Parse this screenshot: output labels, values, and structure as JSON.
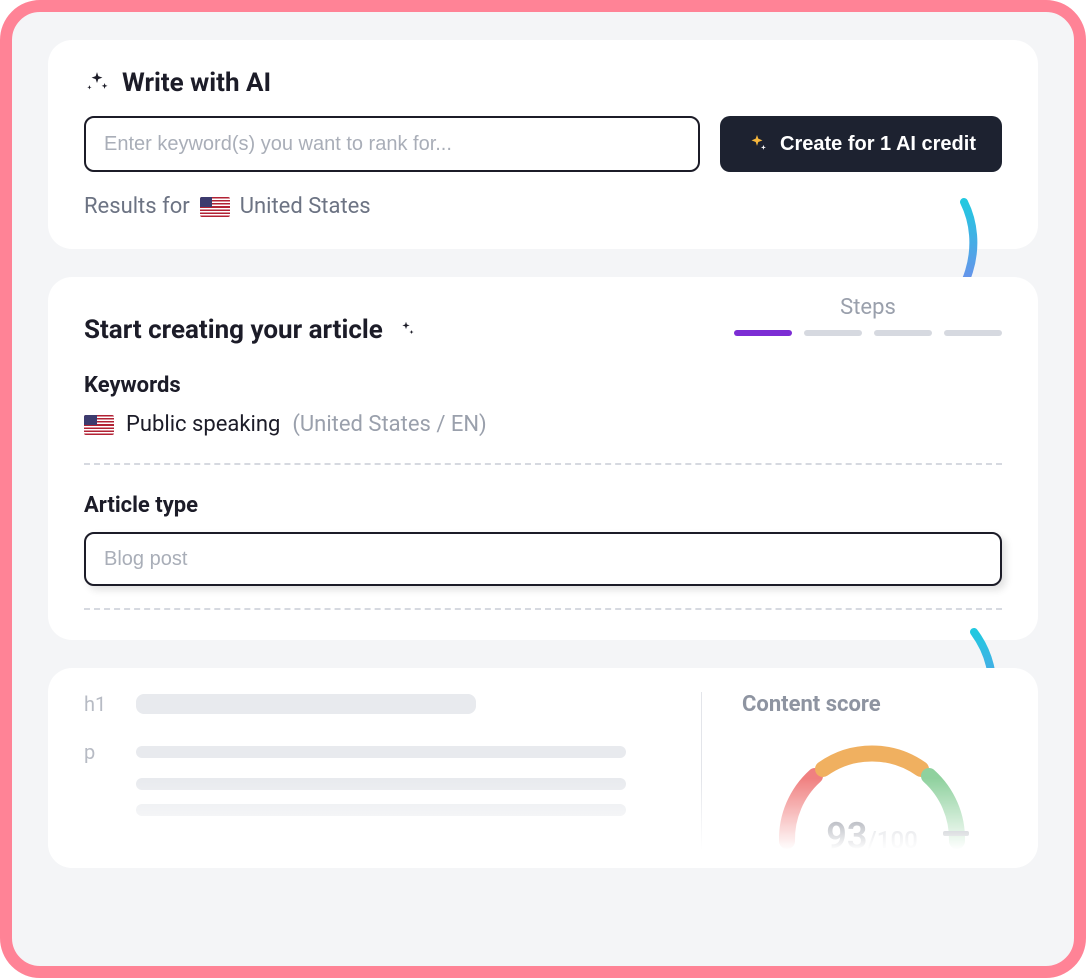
{
  "card1": {
    "title": "Write with AI",
    "keyword_placeholder": "Enter keyword(s) you want to rank for...",
    "create_button": "Create for 1 AI credit",
    "results_prefix": "Results for",
    "results_country": "United States"
  },
  "card2": {
    "title": "Start creating your article",
    "steps_label": "Steps",
    "keywords_label": "Keywords",
    "keyword_value": "Public speaking",
    "keyword_meta": "(United States / EN)",
    "article_type_label": "Article type",
    "article_type_placeholder": "Blog post"
  },
  "card3": {
    "h1_tag": "h1",
    "p_tag": "p",
    "score_title": "Content score",
    "score_value": "93",
    "score_sep": "/",
    "score_max": "100"
  }
}
